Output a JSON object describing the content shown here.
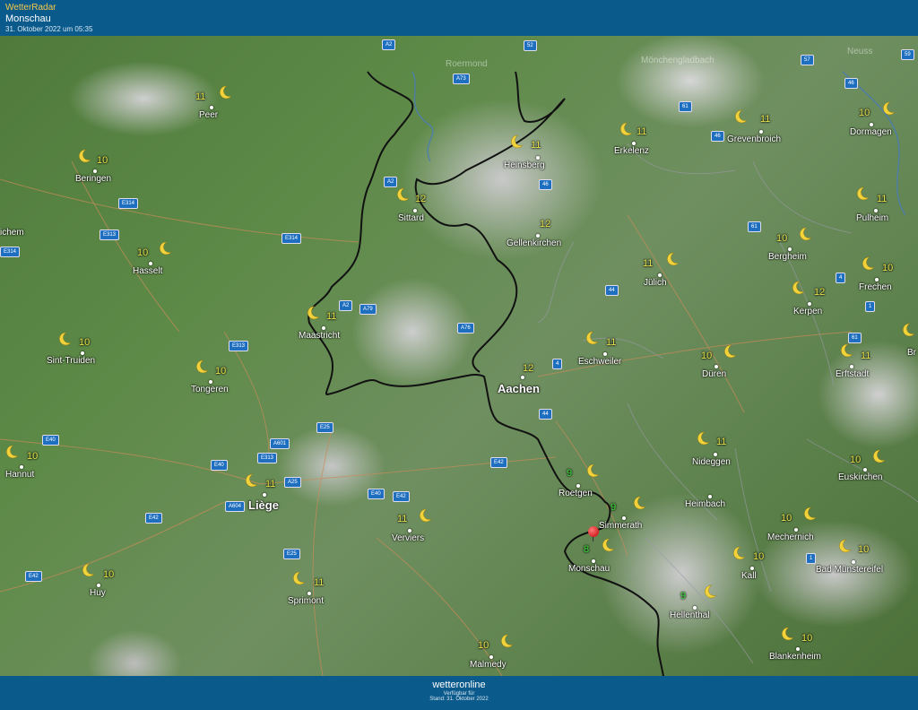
{
  "header": {
    "brand": "WetterRadar",
    "location": "Monschau",
    "timestamp": "31. Oktober 2022 um 05:35"
  },
  "footer": {
    "logo": "wetteronline",
    "available": "Verfügbar für",
    "stand": "Stand: 31. Oktober 2022"
  },
  "roads": [
    "A2",
    "52",
    "57",
    "59",
    "A73",
    "46",
    "61",
    "46",
    "A2",
    "46",
    "E314",
    "E313",
    "E314",
    "E314",
    "61",
    "4",
    "44",
    "1",
    "A2",
    "A79",
    "A76",
    "4",
    "61",
    "E313",
    "44",
    "A601",
    "E25",
    "E40",
    "E313",
    "E40",
    "A25",
    "A604",
    "E42",
    "E40",
    "E42",
    "E25",
    "E42",
    "1",
    "E42"
  ],
  "cities": [
    {
      "name": "Roermond",
      "faded": true
    },
    {
      "name": "Mönchengladbach",
      "faded": true
    },
    {
      "name": "Neuss",
      "faded": true
    },
    {
      "name": "Peer"
    },
    {
      "name": "Beringen"
    },
    {
      "name": "ichem"
    },
    {
      "name": "Hasselt"
    },
    {
      "name": "Sint-Truiden"
    },
    {
      "name": "Tongeren"
    },
    {
      "name": "Hannut"
    },
    {
      "name": "Liège",
      "big": true
    },
    {
      "name": "Huy"
    },
    {
      "name": "Sprimont"
    },
    {
      "name": "Verviers"
    },
    {
      "name": "Malmedy"
    },
    {
      "name": "Maastricht"
    },
    {
      "name": "Sittard"
    },
    {
      "name": "Heinsberg"
    },
    {
      "name": "Gellenkirchen"
    },
    {
      "name": "Aachen",
      "big": true
    },
    {
      "name": "Erkelenz"
    },
    {
      "name": "Grevenbroich"
    },
    {
      "name": "Dormagen"
    },
    {
      "name": "Pulheim"
    },
    {
      "name": "Bergheim"
    },
    {
      "name": "Jülich"
    },
    {
      "name": "Frechen"
    },
    {
      "name": "Kerpen"
    },
    {
      "name": "Eschweiler"
    },
    {
      "name": "Düren"
    },
    {
      "name": "Erftstadt"
    },
    {
      "name": "Br"
    },
    {
      "name": "Nideggen"
    },
    {
      "name": "Roetgen"
    },
    {
      "name": "Heimbach"
    },
    {
      "name": "Simmerath"
    },
    {
      "name": "Monschau"
    },
    {
      "name": "Euskirchen"
    },
    {
      "name": "Mechernich"
    },
    {
      "name": "Kall"
    },
    {
      "name": "Bad Münstereifel"
    },
    {
      "name": "Hellenthal"
    },
    {
      "name": "Blankenheim"
    }
  ],
  "temps": [
    "11",
    "10",
    "10",
    "10",
    "10",
    "10",
    "11",
    "10",
    "11",
    "11",
    "10",
    "11",
    "12",
    "11",
    "12",
    "12",
    "11",
    "11",
    "10",
    "11",
    "10",
    "11",
    "10",
    "12",
    "11",
    "10",
    "11",
    "9",
    "11",
    "9",
    "8",
    "10",
    "10",
    "10",
    "10",
    "9",
    "10"
  ],
  "colors": {
    "warm": "#e6e14a",
    "cool": "#3ee23e",
    "header": "#0b5a8c",
    "road": "#1f6fc0",
    "border": "#111111"
  }
}
